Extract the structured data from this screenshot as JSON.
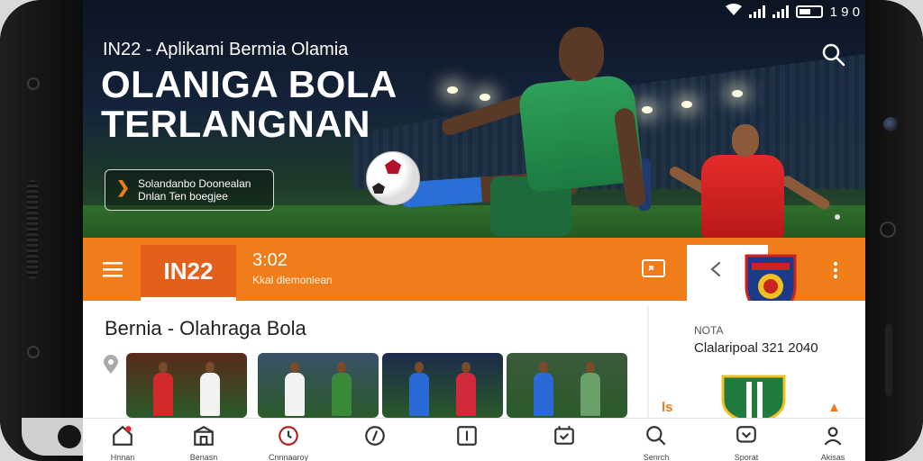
{
  "status_bar": {
    "time": "1 9 0"
  },
  "hero": {
    "subtitle": "IN22 - Aplikami Bermia Olamia",
    "title_line1": "OLANIGA BOLA",
    "title_line2": "TERLANGNAN",
    "cta_line1": "Solandanbo Doonealan",
    "cta_line2": "Dnlan Ten boegjee",
    "cta_icon": "chevron-right-icon",
    "search_icon": "search-icon"
  },
  "topbar": {
    "logo": "IN22",
    "score": "3:02",
    "score_sub": "Kkal dlemonlean",
    "menu_icon": "menu-icon",
    "cast_icon": "cast-icon",
    "back_icon": "back-icon",
    "more_icon": "more-vertical-icon",
    "accent_color": "#f07d1a"
  },
  "main": {
    "section_title": "Bernia - Olahraga Bola",
    "thumbnails": [
      {
        "bg": "#5a2a1a",
        "fig1": "#d22a2a",
        "fig2": "#f2f2f2"
      },
      {
        "bg": "#3a5068",
        "fig1": "#f2f2f2",
        "fig2": "#3a8a3a"
      },
      {
        "bg": "#1c2a4a",
        "fig1": "#2a6ad6",
        "fig2": "#d22a3a"
      },
      {
        "bg": "#3c5a3c",
        "fig1": "#2a6ad6",
        "fig2": "#6aa06a"
      }
    ]
  },
  "right_panel": {
    "label": "NOTA",
    "value": "Clalaripoal 321 2040",
    "fire_left": "ls"
  },
  "bottom_nav": {
    "items": [
      {
        "label": "Hnnan",
        "icon": "home-icon"
      },
      {
        "label": "Benasn",
        "icon": "store-icon"
      },
      {
        "label": "Cnnnaaroy",
        "icon": "clock-icon"
      },
      {
        "label": "",
        "icon": "compass-icon"
      },
      {
        "label": "",
        "icon": "calendar-icon"
      },
      {
        "label": "",
        "icon": "ticket-icon"
      },
      {
        "label": "Senrch",
        "icon": "search-icon"
      },
      {
        "label": "Sporat",
        "icon": "chat-icon"
      },
      {
        "label": "Akisas",
        "icon": "profile-icon"
      }
    ]
  }
}
